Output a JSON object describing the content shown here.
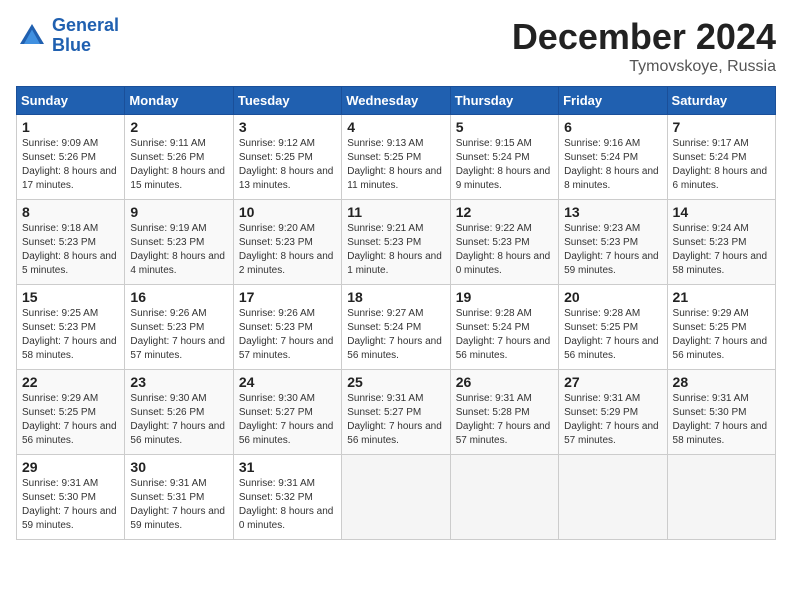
{
  "logo": {
    "line1": "General",
    "line2": "Blue"
  },
  "title": "December 2024",
  "location": "Tymovskoye, Russia",
  "days_of_week": [
    "Sunday",
    "Monday",
    "Tuesday",
    "Wednesday",
    "Thursday",
    "Friday",
    "Saturday"
  ],
  "weeks": [
    [
      {
        "num": "1",
        "sunrise": "9:09 AM",
        "sunset": "5:26 PM",
        "daylight": "8 hours and 17 minutes."
      },
      {
        "num": "2",
        "sunrise": "9:11 AM",
        "sunset": "5:26 PM",
        "daylight": "8 hours and 15 minutes."
      },
      {
        "num": "3",
        "sunrise": "9:12 AM",
        "sunset": "5:25 PM",
        "daylight": "8 hours and 13 minutes."
      },
      {
        "num": "4",
        "sunrise": "9:13 AM",
        "sunset": "5:25 PM",
        "daylight": "8 hours and 11 minutes."
      },
      {
        "num": "5",
        "sunrise": "9:15 AM",
        "sunset": "5:24 PM",
        "daylight": "8 hours and 9 minutes."
      },
      {
        "num": "6",
        "sunrise": "9:16 AM",
        "sunset": "5:24 PM",
        "daylight": "8 hours and 8 minutes."
      },
      {
        "num": "7",
        "sunrise": "9:17 AM",
        "sunset": "5:24 PM",
        "daylight": "8 hours and 6 minutes."
      }
    ],
    [
      {
        "num": "8",
        "sunrise": "9:18 AM",
        "sunset": "5:23 PM",
        "daylight": "8 hours and 5 minutes."
      },
      {
        "num": "9",
        "sunrise": "9:19 AM",
        "sunset": "5:23 PM",
        "daylight": "8 hours and 4 minutes."
      },
      {
        "num": "10",
        "sunrise": "9:20 AM",
        "sunset": "5:23 PM",
        "daylight": "8 hours and 2 minutes."
      },
      {
        "num": "11",
        "sunrise": "9:21 AM",
        "sunset": "5:23 PM",
        "daylight": "8 hours and 1 minute."
      },
      {
        "num": "12",
        "sunrise": "9:22 AM",
        "sunset": "5:23 PM",
        "daylight": "8 hours and 0 minutes."
      },
      {
        "num": "13",
        "sunrise": "9:23 AM",
        "sunset": "5:23 PM",
        "daylight": "7 hours and 59 minutes."
      },
      {
        "num": "14",
        "sunrise": "9:24 AM",
        "sunset": "5:23 PM",
        "daylight": "7 hours and 58 minutes."
      }
    ],
    [
      {
        "num": "15",
        "sunrise": "9:25 AM",
        "sunset": "5:23 PM",
        "daylight": "7 hours and 58 minutes."
      },
      {
        "num": "16",
        "sunrise": "9:26 AM",
        "sunset": "5:23 PM",
        "daylight": "7 hours and 57 minutes."
      },
      {
        "num": "17",
        "sunrise": "9:26 AM",
        "sunset": "5:23 PM",
        "daylight": "7 hours and 57 minutes."
      },
      {
        "num": "18",
        "sunrise": "9:27 AM",
        "sunset": "5:24 PM",
        "daylight": "7 hours and 56 minutes."
      },
      {
        "num": "19",
        "sunrise": "9:28 AM",
        "sunset": "5:24 PM",
        "daylight": "7 hours and 56 minutes."
      },
      {
        "num": "20",
        "sunrise": "9:28 AM",
        "sunset": "5:25 PM",
        "daylight": "7 hours and 56 minutes."
      },
      {
        "num": "21",
        "sunrise": "9:29 AM",
        "sunset": "5:25 PM",
        "daylight": "7 hours and 56 minutes."
      }
    ],
    [
      {
        "num": "22",
        "sunrise": "9:29 AM",
        "sunset": "5:25 PM",
        "daylight": "7 hours and 56 minutes."
      },
      {
        "num": "23",
        "sunrise": "9:30 AM",
        "sunset": "5:26 PM",
        "daylight": "7 hours and 56 minutes."
      },
      {
        "num": "24",
        "sunrise": "9:30 AM",
        "sunset": "5:27 PM",
        "daylight": "7 hours and 56 minutes."
      },
      {
        "num": "25",
        "sunrise": "9:31 AM",
        "sunset": "5:27 PM",
        "daylight": "7 hours and 56 minutes."
      },
      {
        "num": "26",
        "sunrise": "9:31 AM",
        "sunset": "5:28 PM",
        "daylight": "7 hours and 57 minutes."
      },
      {
        "num": "27",
        "sunrise": "9:31 AM",
        "sunset": "5:29 PM",
        "daylight": "7 hours and 57 minutes."
      },
      {
        "num": "28",
        "sunrise": "9:31 AM",
        "sunset": "5:30 PM",
        "daylight": "7 hours and 58 minutes."
      }
    ],
    [
      {
        "num": "29",
        "sunrise": "9:31 AM",
        "sunset": "5:30 PM",
        "daylight": "7 hours and 59 minutes."
      },
      {
        "num": "30",
        "sunrise": "9:31 AM",
        "sunset": "5:31 PM",
        "daylight": "7 hours and 59 minutes."
      },
      {
        "num": "31",
        "sunrise": "9:31 AM",
        "sunset": "5:32 PM",
        "daylight": "8 hours and 0 minutes."
      },
      null,
      null,
      null,
      null
    ]
  ]
}
